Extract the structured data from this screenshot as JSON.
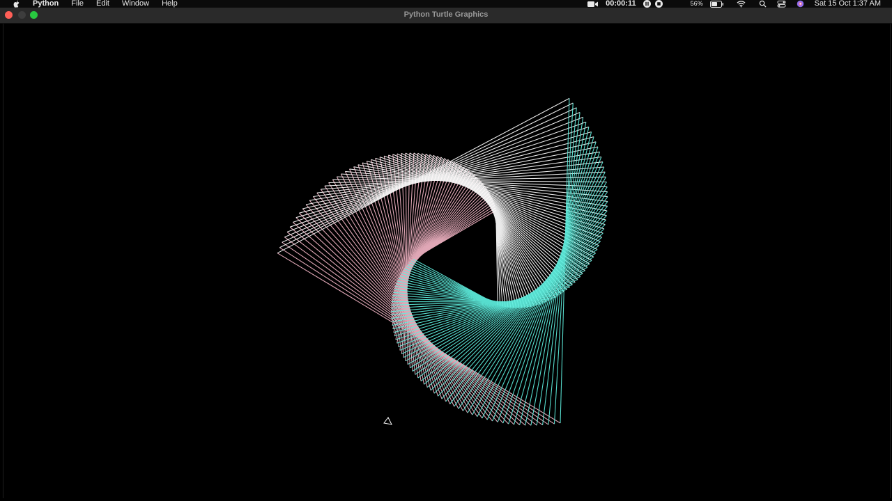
{
  "menubar": {
    "apple_icon": "apple-logo-icon",
    "app_name": "Python",
    "menus": [
      "File",
      "Edit",
      "Window",
      "Help"
    ],
    "recording_time": "00:00:11",
    "battery_percent": "56%",
    "datetime": "Sat 15 Oct  1:37 AM"
  },
  "window": {
    "title": "Python Turtle Graphics"
  },
  "turtle": {
    "colors": [
      "#5ff0e0",
      "#f4b6c6",
      "#ffffff"
    ],
    "background": "#000000"
  }
}
